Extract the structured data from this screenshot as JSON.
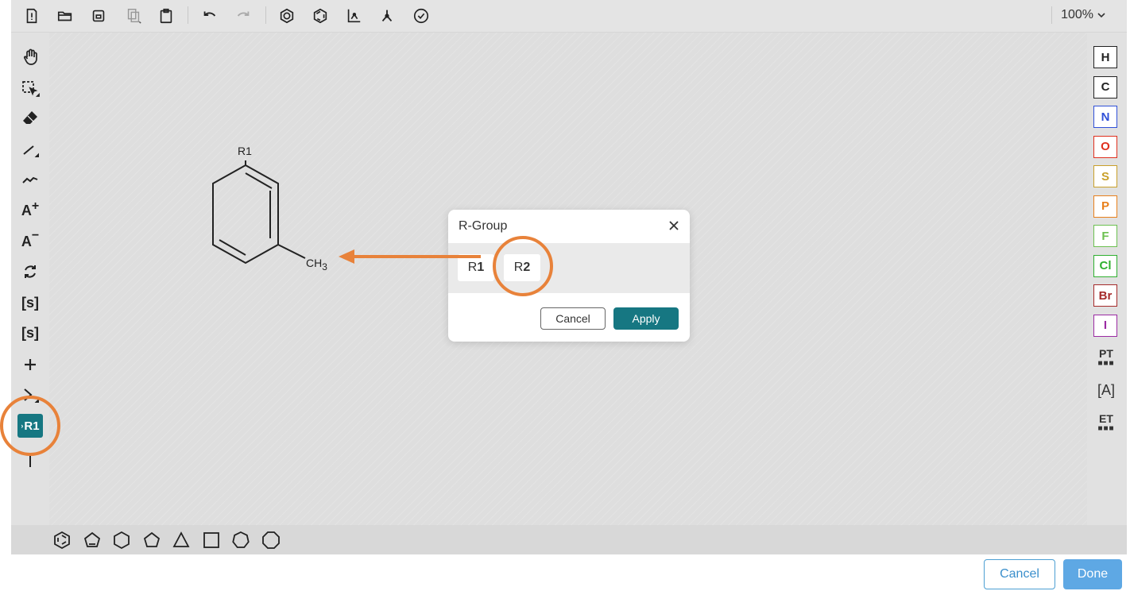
{
  "topbar": {
    "icons": [
      "clear-canvas-icon",
      "open-icon",
      "save-icon",
      "copy-icon",
      "paste-icon",
      "undo-icon",
      "redo-icon",
      "aromatize-icon",
      "dearomatize-icon",
      "layout-icon",
      "clean-up-icon",
      "check-structure-icon"
    ],
    "zoom_label": "100%"
  },
  "left_toolbar": {
    "tools": [
      "hand-tool",
      "select-tool",
      "erase-tool",
      "bond-tool",
      "chain-tool",
      "charge-plus-tool",
      "charge-minus-tool",
      "rotate-tool",
      "sgroup-tool",
      "data-sgroup-tool",
      "reaction-plus-tool",
      "reaction-arrow-tool",
      "rgroup-tool",
      "rgroup-attachment-tool"
    ],
    "charge_plus_label": "A",
    "charge_minus_label": "A",
    "sgroup_label": "[s]",
    "data_sgroup_label": "[s]",
    "rgroup_label": "R1"
  },
  "right_toolbar": {
    "atoms": [
      {
        "symbol": "H",
        "color": "#222222"
      },
      {
        "symbol": "C",
        "color": "#222222"
      },
      {
        "symbol": "N",
        "color": "#3050d8"
      },
      {
        "symbol": "O",
        "color": "#e0301e"
      },
      {
        "symbol": "S",
        "color": "#c9a02a"
      },
      {
        "symbol": "P",
        "color": "#e8801c"
      },
      {
        "symbol": "F",
        "color": "#6cc050"
      },
      {
        "symbol": "Cl",
        "color": "#2fb030"
      },
      {
        "symbol": "Br",
        "color": "#a52a2a"
      },
      {
        "symbol": "I",
        "color": "#9b2ba3"
      }
    ],
    "periodic_table_label": "PT",
    "any_atom_label": "A",
    "extended_table_label": "ET"
  },
  "molecule": {
    "r_label": "R1",
    "substituent_label": "CH",
    "substituent_subscript": "3"
  },
  "dialog": {
    "title": "R-Group",
    "groups": [
      {
        "prefix": "R",
        "number": "1"
      },
      {
        "prefix": "R",
        "number": "2"
      }
    ],
    "cancel_label": "Cancel",
    "apply_label": "Apply"
  },
  "bottom_toolbar": {
    "shapes": [
      "benzene-icon",
      "cyclopentadiene-icon",
      "cyclohexane-icon",
      "cyclopentane-icon",
      "cyclopropane-icon",
      "cyclobutane-icon",
      "cycloheptane-icon",
      "cyclooctane-icon"
    ]
  },
  "footer": {
    "cancel_label": "Cancel",
    "done_label": "Done"
  },
  "colors": {
    "accent": "#167782",
    "annotation": "#e8823a",
    "footer_done": "#5ea8e4"
  }
}
